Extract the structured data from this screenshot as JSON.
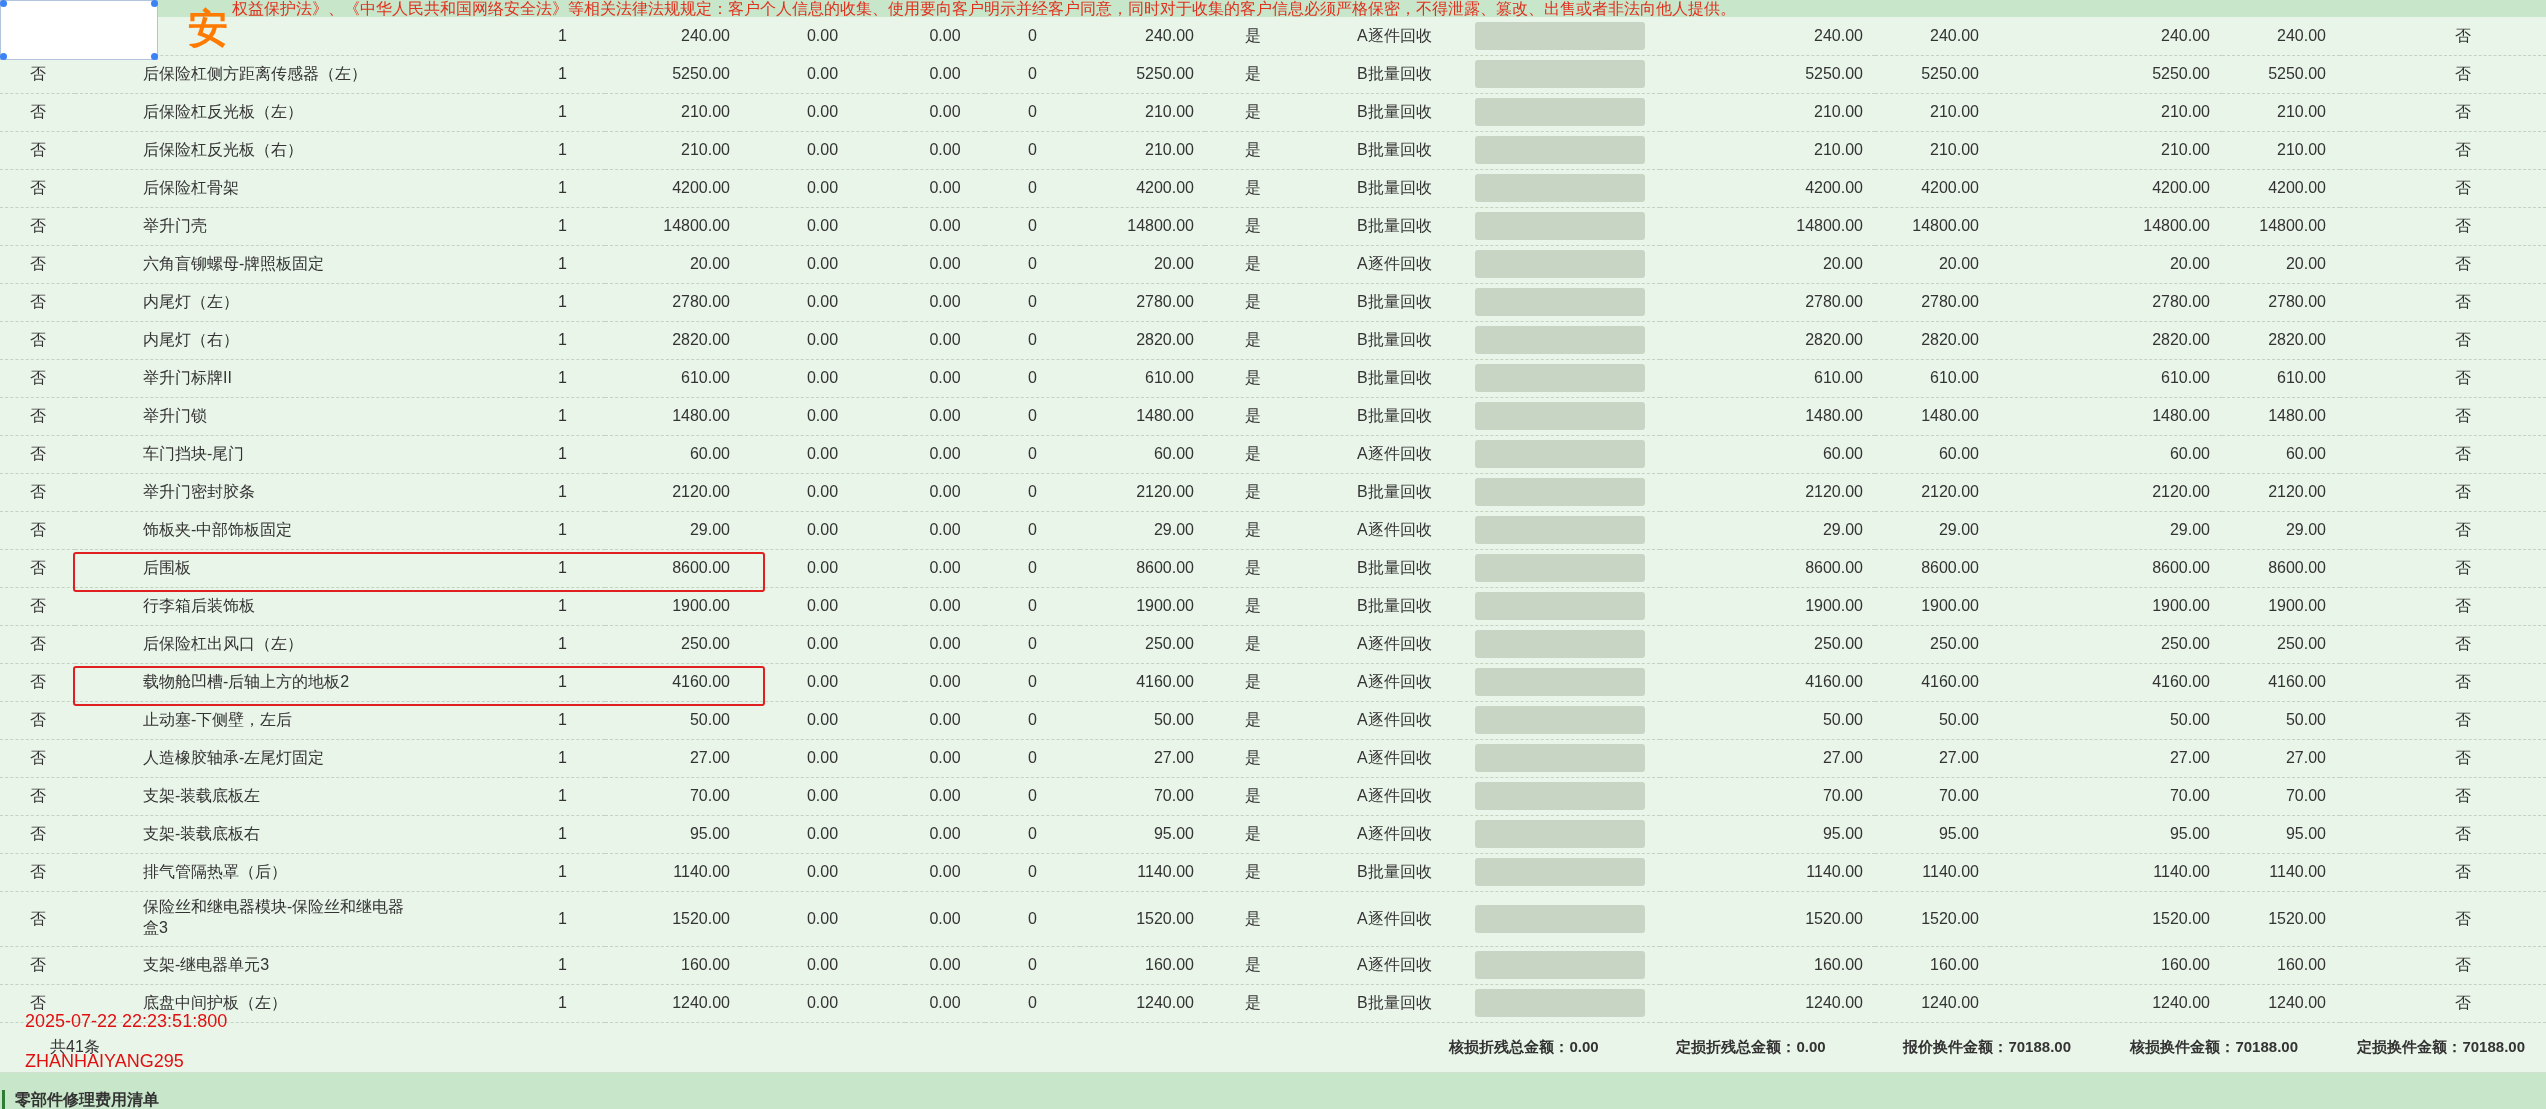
{
  "banner": {
    "text": "权益保护法》、《中华人民共和国网络安全法》等相关法律法规规定：客户个人信息的收集、使用要向客户明示并经客户同意，同时对于收集的客户信息必须严格保密，不得泄露、篡改、出售或者非法向他人提供。"
  },
  "overlay": {
    "glyph": "安",
    "selection_box": true
  },
  "table": {
    "rows": [
      {
        "column_3": "1",
        "column_4": "240.00",
        "column_5": "0.00",
        "column_6": "0.00",
        "column_7": "0",
        "column_8": "240.00",
        "column_9": "是",
        "column_10": "A逐件回收",
        "redacted": true,
        "column_12": "240.00",
        "column_13": "240.00",
        "column_14": "240.00",
        "column_15": "240.00",
        "column_16": "否",
        "annotated": false
      },
      {
        "column_1": "否",
        "column_2": "后保险杠侧方距离传感器（左）",
        "column_3": "1",
        "column_4": "5250.00",
        "column_5": "0.00",
        "column_6": "0.00",
        "column_7": "0",
        "column_8": "5250.00",
        "column_9": "是",
        "column_10": "B批量回收",
        "redacted": true,
        "column_12": "5250.00",
        "column_13": "5250.00",
        "column_14": "5250.00",
        "column_15": "5250.00",
        "column_16": "否",
        "annotated": false
      },
      {
        "column_1": "否",
        "column_2": "后保险杠反光板（左）",
        "column_3": "1",
        "column_4": "210.00",
        "column_5": "0.00",
        "column_6": "0.00",
        "column_7": "0",
        "column_8": "210.00",
        "column_9": "是",
        "column_10": "B批量回收",
        "redacted": true,
        "column_12": "210.00",
        "column_13": "210.00",
        "column_14": "210.00",
        "column_15": "210.00",
        "column_16": "否",
        "annotated": false
      },
      {
        "column_1": "否",
        "column_2": "后保险杠反光板（右）",
        "column_3": "1",
        "column_4": "210.00",
        "column_5": "0.00",
        "column_6": "0.00",
        "column_7": "0",
        "column_8": "210.00",
        "column_9": "是",
        "column_10": "B批量回收",
        "redacted": true,
        "column_12": "210.00",
        "column_13": "210.00",
        "column_14": "210.00",
        "column_15": "210.00",
        "column_16": "否",
        "annotated": false
      },
      {
        "column_1": "否",
        "column_2": "后保险杠骨架",
        "column_3": "1",
        "column_4": "4200.00",
        "column_5": "0.00",
        "column_6": "0.00",
        "column_7": "0",
        "column_8": "4200.00",
        "column_9": "是",
        "column_10": "B批量回收",
        "redacted": true,
        "column_12": "4200.00",
        "column_13": "4200.00",
        "column_14": "4200.00",
        "column_15": "4200.00",
        "column_16": "否",
        "annotated": false
      },
      {
        "column_1": "否",
        "column_2": "举升门壳",
        "column_3": "1",
        "column_4": "14800.00",
        "column_5": "0.00",
        "column_6": "0.00",
        "column_7": "0",
        "column_8": "14800.00",
        "column_9": "是",
        "column_10": "B批量回收",
        "redacted": true,
        "column_12": "14800.00",
        "column_13": "14800.00",
        "column_14": "14800.00",
        "column_15": "14800.00",
        "column_16": "否",
        "annotated": false
      },
      {
        "column_1": "否",
        "column_2": "六角盲铆螺母-牌照板固定",
        "column_3": "1",
        "column_4": "20.00",
        "column_5": "0.00",
        "column_6": "0.00",
        "column_7": "0",
        "column_8": "20.00",
        "column_9": "是",
        "column_10": "A逐件回收",
        "redacted": true,
        "column_12": "20.00",
        "column_13": "20.00",
        "column_14": "20.00",
        "column_15": "20.00",
        "column_16": "否",
        "annotated": false
      },
      {
        "column_1": "否",
        "column_2": "内尾灯（左）",
        "column_3": "1",
        "column_4": "2780.00",
        "column_5": "0.00",
        "column_6": "0.00",
        "column_7": "0",
        "column_8": "2780.00",
        "column_9": "是",
        "column_10": "B批量回收",
        "redacted": true,
        "column_12": "2780.00",
        "column_13": "2780.00",
        "column_14": "2780.00",
        "column_15": "2780.00",
        "column_16": "否",
        "annotated": false
      },
      {
        "column_1": "否",
        "column_2": "内尾灯（右）",
        "column_3": "1",
        "column_4": "2820.00",
        "column_5": "0.00",
        "column_6": "0.00",
        "column_7": "0",
        "column_8": "2820.00",
        "column_9": "是",
        "column_10": "B批量回收",
        "redacted": true,
        "column_12": "2820.00",
        "column_13": "2820.00",
        "column_14": "2820.00",
        "column_15": "2820.00",
        "column_16": "否",
        "annotated": false
      },
      {
        "column_1": "否",
        "column_2": "举升门标牌II",
        "column_3": "1",
        "column_4": "610.00",
        "column_5": "0.00",
        "column_6": "0.00",
        "column_7": "0",
        "column_8": "610.00",
        "column_9": "是",
        "column_10": "B批量回收",
        "redacted": true,
        "column_12": "610.00",
        "column_13": "610.00",
        "column_14": "610.00",
        "column_15": "610.00",
        "column_16": "否",
        "annotated": false
      },
      {
        "column_1": "否",
        "column_2": "举升门锁",
        "column_3": "1",
        "column_4": "1480.00",
        "column_5": "0.00",
        "column_6": "0.00",
        "column_7": "0",
        "column_8": "1480.00",
        "column_9": "是",
        "column_10": "B批量回收",
        "redacted": true,
        "column_12": "1480.00",
        "column_13": "1480.00",
        "column_14": "1480.00",
        "column_15": "1480.00",
        "column_16": "否",
        "annotated": false
      },
      {
        "column_1": "否",
        "column_2": "车门挡块-尾门",
        "column_3": "1",
        "column_4": "60.00",
        "column_5": "0.00",
        "column_6": "0.00",
        "column_7": "0",
        "column_8": "60.00",
        "column_9": "是",
        "column_10": "A逐件回收",
        "redacted": true,
        "column_12": "60.00",
        "column_13": "60.00",
        "column_14": "60.00",
        "column_15": "60.00",
        "column_16": "否",
        "annotated": false
      },
      {
        "column_1": "否",
        "column_2": "举升门密封胶条",
        "column_3": "1",
        "column_4": "2120.00",
        "column_5": "0.00",
        "column_6": "0.00",
        "column_7": "0",
        "column_8": "2120.00",
        "column_9": "是",
        "column_10": "B批量回收",
        "redacted": true,
        "column_12": "2120.00",
        "column_13": "2120.00",
        "column_14": "2120.00",
        "column_15": "2120.00",
        "column_16": "否",
        "annotated": false
      },
      {
        "column_1": "否",
        "column_2": "饰板夹-中部饰板固定",
        "column_3": "1",
        "column_4": "29.00",
        "column_5": "0.00",
        "column_6": "0.00",
        "column_7": "0",
        "column_8": "29.00",
        "column_9": "是",
        "column_10": "A逐件回收",
        "redacted": true,
        "column_12": "29.00",
        "column_13": "29.00",
        "column_14": "29.00",
        "column_15": "29.00",
        "column_16": "否",
        "annotated": false
      },
      {
        "column_1": "否",
        "column_2": "后围板",
        "column_3": "1",
        "column_4": "8600.00",
        "column_5": "0.00",
        "column_6": "0.00",
        "column_7": "0",
        "column_8": "8600.00",
        "column_9": "是",
        "column_10": "B批量回收",
        "redacted": true,
        "column_12": "8600.00",
        "column_13": "8600.00",
        "column_14": "8600.00",
        "column_15": "8600.00",
        "column_16": "否",
        "annotated": true
      },
      {
        "column_1": "否",
        "column_2": "行李箱后装饰板",
        "column_3": "1",
        "column_4": "1900.00",
        "column_5": "0.00",
        "column_6": "0.00",
        "column_7": "0",
        "column_8": "1900.00",
        "column_9": "是",
        "column_10": "B批量回收",
        "redacted": true,
        "column_12": "1900.00",
        "column_13": "1900.00",
        "column_14": "1900.00",
        "column_15": "1900.00",
        "column_16": "否",
        "annotated": false
      },
      {
        "column_1": "否",
        "column_2": "后保险杠出风口（左）",
        "column_3": "1",
        "column_4": "250.00",
        "column_5": "0.00",
        "column_6": "0.00",
        "column_7": "0",
        "column_8": "250.00",
        "column_9": "是",
        "column_10": "A逐件回收",
        "redacted": true,
        "column_12": "250.00",
        "column_13": "250.00",
        "column_14": "250.00",
        "column_15": "250.00",
        "column_16": "否",
        "annotated": false
      },
      {
        "column_1": "否",
        "column_2": "载物舱凹槽-后轴上方的地板2",
        "column_3": "1",
        "column_4": "4160.00",
        "column_5": "0.00",
        "column_6": "0.00",
        "column_7": "0",
        "column_8": "4160.00",
        "column_9": "是",
        "column_10": "A逐件回收",
        "redacted": true,
        "column_12": "4160.00",
        "column_13": "4160.00",
        "column_14": "4160.00",
        "column_15": "4160.00",
        "column_16": "否",
        "annotated": true
      },
      {
        "column_1": "否",
        "column_2": "止动塞-下侧壁，左后",
        "column_3": "1",
        "column_4": "50.00",
        "column_5": "0.00",
        "column_6": "0.00",
        "column_7": "0",
        "column_8": "50.00",
        "column_9": "是",
        "column_10": "A逐件回收",
        "redacted": true,
        "column_12": "50.00",
        "column_13": "50.00",
        "column_14": "50.00",
        "column_15": "50.00",
        "column_16": "否",
        "annotated": false
      },
      {
        "column_1": "否",
        "column_2": "人造橡胶轴承-左尾灯固定",
        "column_3": "1",
        "column_4": "27.00",
        "column_5": "0.00",
        "column_6": "0.00",
        "column_7": "0",
        "column_8": "27.00",
        "column_9": "是",
        "column_10": "A逐件回收",
        "redacted": true,
        "column_12": "27.00",
        "column_13": "27.00",
        "column_14": "27.00",
        "column_15": "27.00",
        "column_16": "否",
        "annotated": false
      },
      {
        "column_1": "否",
        "column_2": "支架-装载底板左",
        "column_3": "1",
        "column_4": "70.00",
        "column_5": "0.00",
        "column_6": "0.00",
        "column_7": "0",
        "column_8": "70.00",
        "column_9": "是",
        "column_10": "A逐件回收",
        "redacted": true,
        "column_12": "70.00",
        "column_13": "70.00",
        "column_14": "70.00",
        "column_15": "70.00",
        "column_16": "否",
        "annotated": false
      },
      {
        "column_1": "否",
        "column_2": "支架-装载底板右",
        "column_3": "1",
        "column_4": "95.00",
        "column_5": "0.00",
        "column_6": "0.00",
        "column_7": "0",
        "column_8": "95.00",
        "column_9": "是",
        "column_10": "A逐件回收",
        "redacted": true,
        "column_12": "95.00",
        "column_13": "95.00",
        "column_14": "95.00",
        "column_15": "95.00",
        "column_16": "否",
        "annotated": false
      },
      {
        "column_1": "否",
        "column_2": "排气管隔热罩（后）",
        "column_3": "1",
        "column_4": "1140.00",
        "column_5": "0.00",
        "column_6": "0.00",
        "column_7": "0",
        "column_8": "1140.00",
        "column_9": "是",
        "column_10": "B批量回收",
        "redacted": true,
        "column_12": "1140.00",
        "column_13": "1140.00",
        "column_14": "1140.00",
        "column_15": "1140.00",
        "column_16": "否",
        "annotated": false
      },
      {
        "column_1": "否",
        "column_2": "保险丝和继电器模块-保险丝和继电器盒3",
        "column_3": "1",
        "column_4": "1520.00",
        "column_5": "0.00",
        "column_6": "0.00",
        "column_7": "0",
        "column_8": "1520.00",
        "column_9": "是",
        "column_10": "A逐件回收",
        "redacted": true,
        "column_12": "1520.00",
        "column_13": "1520.00",
        "column_14": "1520.00",
        "column_15": "1520.00",
        "column_16": "否",
        "annotated": false
      },
      {
        "column_1": "否",
        "column_2": "支架-继电器单元3",
        "column_3": "1",
        "column_4": "160.00",
        "column_5": "0.00",
        "column_6": "0.00",
        "column_7": "0",
        "column_8": "160.00",
        "column_9": "是",
        "column_10": "A逐件回收",
        "redacted": true,
        "column_12": "160.00",
        "column_13": "160.00",
        "column_14": "160.00",
        "column_15": "160.00",
        "column_16": "否",
        "annotated": false
      },
      {
        "column_1": "否",
        "column_2": "底盘中间护板（左）",
        "column_3": "1",
        "column_4": "1240.00",
        "column_5": "0.00",
        "column_6": "0.00",
        "column_7": "0",
        "column_8": "1240.00",
        "column_9": "是",
        "column_10": "B批量回收",
        "redacted": true,
        "column_12": "1240.00",
        "column_13": "1240.00",
        "column_14": "1240.00",
        "column_15": "1240.00",
        "column_16": "否",
        "annotated": false
      }
    ]
  },
  "summary": {
    "count": "共41条",
    "totals": [
      "核损折残总金额：0.00",
      "定损折残总金额：0.00",
      "报价换件金额：70188.00",
      "核损换件金额：70188.00",
      "定损换件金额：70188.00"
    ]
  },
  "section_header": {
    "title": "零部件修理费用清单"
  },
  "stamps": [
    "2025-07-22 22:23:51:800",
    "ZHANHAIYANG295"
  ]
}
